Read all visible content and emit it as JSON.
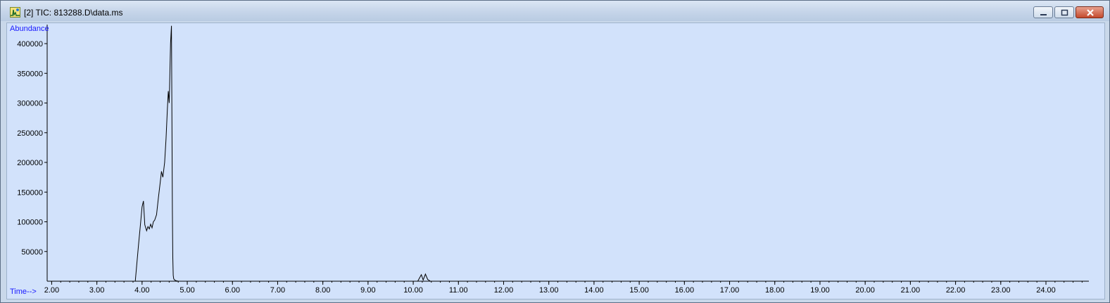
{
  "window": {
    "title": "[2] TIC: 813288.D\\data.ms",
    "icon": "chromatogram-app-icon",
    "controls": [
      "minimize",
      "restore",
      "close"
    ]
  },
  "chart_data": {
    "type": "line",
    "title": "",
    "ylabel": "Abundance",
    "xlabel": "Time-->",
    "xlim": [
      1.9,
      24.95
    ],
    "ylim": [
      0,
      432000
    ],
    "x_ticks": [
      "2.00",
      "3.00",
      "4.00",
      "5.00",
      "6.00",
      "7.00",
      "8.00",
      "9.00",
      "10.00",
      "11.00",
      "12.00",
      "13.00",
      "14.00",
      "15.00",
      "16.00",
      "17.00",
      "18.00",
      "19.00",
      "20.00",
      "21.00",
      "22.00",
      "23.00",
      "24.00"
    ],
    "y_ticks": [
      "50000",
      "100000",
      "150000",
      "200000",
      "250000",
      "300000",
      "350000",
      "400000"
    ],
    "series": [
      {
        "color": "#000000",
        "x": [
          1.9,
          3.85,
          3.92,
          3.97,
          4.0,
          4.03,
          4.06,
          4.08,
          4.1,
          4.13,
          4.16,
          4.19,
          4.22,
          4.25,
          4.28,
          4.32,
          4.36,
          4.4,
          4.43,
          4.46,
          4.5,
          4.53,
          4.56,
          4.58,
          4.6,
          4.63,
          4.65,
          4.67,
          4.68,
          4.69,
          4.7,
          4.72,
          4.75,
          4.8,
          5.0,
          10.1,
          10.18,
          10.22,
          10.27,
          10.32,
          10.38,
          10.45,
          24.95
        ],
        "y": [
          0,
          0,
          60000,
          100000,
          125000,
          135000,
          95000,
          90000,
          85000,
          92000,
          88000,
          96000,
          90000,
          100000,
          103000,
          112000,
          140000,
          165000,
          185000,
          175000,
          200000,
          240000,
          290000,
          320000,
          300000,
          400000,
          430000,
          120000,
          40000,
          10000,
          4000,
          2000,
          1000,
          0,
          0,
          0,
          11000,
          2000,
          12000,
          3000,
          0,
          0,
          0
        ]
      }
    ]
  }
}
